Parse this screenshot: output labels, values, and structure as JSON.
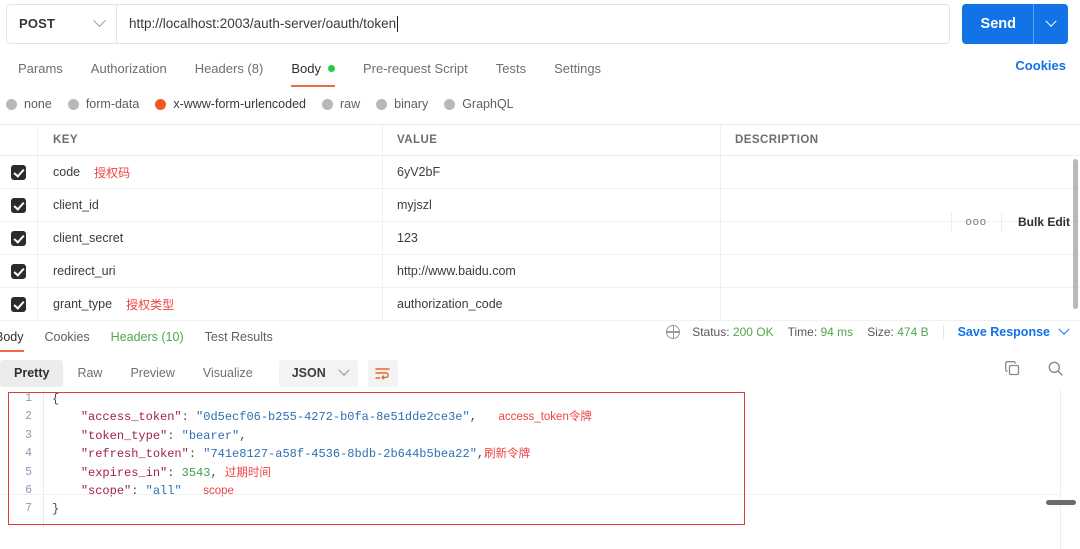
{
  "request": {
    "method": "POST",
    "url": "http://localhost:2003/auth-server/oauth/token",
    "send_label": "Send"
  },
  "request_tabs": [
    {
      "label": "Params",
      "active": false
    },
    {
      "label": "Authorization",
      "active": false
    },
    {
      "label": "Headers (8)",
      "active": false
    },
    {
      "label": "Body",
      "active": true,
      "dot": true
    },
    {
      "label": "Pre-request Script",
      "active": false
    },
    {
      "label": "Tests",
      "active": false
    },
    {
      "label": "Settings",
      "active": false
    }
  ],
  "cookies_link": "Cookies",
  "body_types": [
    {
      "label": "none",
      "selected": false
    },
    {
      "label": "form-data",
      "selected": false
    },
    {
      "label": "x-www-form-urlencoded",
      "selected": true
    },
    {
      "label": "raw",
      "selected": false
    },
    {
      "label": "binary",
      "selected": false
    },
    {
      "label": "GraphQL",
      "selected": false
    }
  ],
  "table": {
    "columns": {
      "key": "KEY",
      "value": "VALUE",
      "description": "DESCRIPTION"
    },
    "ellipsis": "ooo",
    "bulk_edit": "Bulk Edit",
    "rows": [
      {
        "checked": true,
        "key": "code",
        "note": "授权码",
        "value": "6yV2bF",
        "description": ""
      },
      {
        "checked": true,
        "key": "client_id",
        "note": "",
        "value": "myjszl",
        "description": ""
      },
      {
        "checked": true,
        "key": "client_secret",
        "note": "",
        "value": "123",
        "description": ""
      },
      {
        "checked": true,
        "key": "redirect_uri",
        "note": "",
        "value": "http://www.baidu.com",
        "description": ""
      },
      {
        "checked": true,
        "key": "grant_type",
        "note": "授权类型",
        "value": "authorization_code",
        "description": ""
      }
    ]
  },
  "response_tabs": [
    {
      "label": "Body",
      "active": true
    },
    {
      "label": "Cookies",
      "active": false
    },
    {
      "label": "Headers (10)",
      "active": false
    },
    {
      "label": "Test Results",
      "active": false
    }
  ],
  "response_meta": {
    "status_label": "Status:",
    "status_value": "200 OK",
    "time_label": "Time:",
    "time_value": "94 ms",
    "size_label": "Size:",
    "size_value": "474 B",
    "save_response": "Save Response"
  },
  "format_bar": {
    "buttons": [
      {
        "label": "Pretty",
        "active": true
      },
      {
        "label": "Raw",
        "active": false
      },
      {
        "label": "Preview",
        "active": false
      },
      {
        "label": "Visualize",
        "active": false
      }
    ],
    "format": "JSON"
  },
  "json_viewer": {
    "line_numbers": [
      "1",
      "2",
      "3",
      "4",
      "5",
      "6",
      "7"
    ],
    "lines": [
      {
        "text": "{"
      },
      {
        "key": "\"access_token\"",
        "sep": ": ",
        "value": "\"0d5ecf06-b255-4272-b0fa-8e51dde2ce3e\"",
        "comma": ",",
        "note": "access_token令牌"
      },
      {
        "key": "\"token_type\"",
        "sep": ": ",
        "value": "\"bearer\"",
        "comma": ",",
        "note": ""
      },
      {
        "key": "\"refresh_token\"",
        "sep": ": ",
        "value": "\"741e8127-a58f-4536-8bdb-2b644b5bea22\"",
        "comma": ",",
        "note": "刷新令牌"
      },
      {
        "key": "\"expires_in\"",
        "sep": ": ",
        "value": "3543",
        "comma": ",",
        "note": "过期时间",
        "numeric": true
      },
      {
        "key": "\"scope\"",
        "sep": ": ",
        "value": "\"all\"",
        "comma": "",
        "note": "scope"
      },
      {
        "text": "}"
      }
    ],
    "parsed": {
      "access_token": "0d5ecf06-b255-4272-b0fa-8e51dde2ce3e",
      "token_type": "bearer",
      "refresh_token": "741e8127-a58f-4536-8bdb-2b644b5bea22",
      "expires_in": 3543,
      "scope": "all"
    }
  },
  "colors": {
    "accent_orange": "#ef6c3f",
    "send_blue": "#1173e6",
    "annotation_red": "#ef4343",
    "status_green": "#4fa64f"
  }
}
